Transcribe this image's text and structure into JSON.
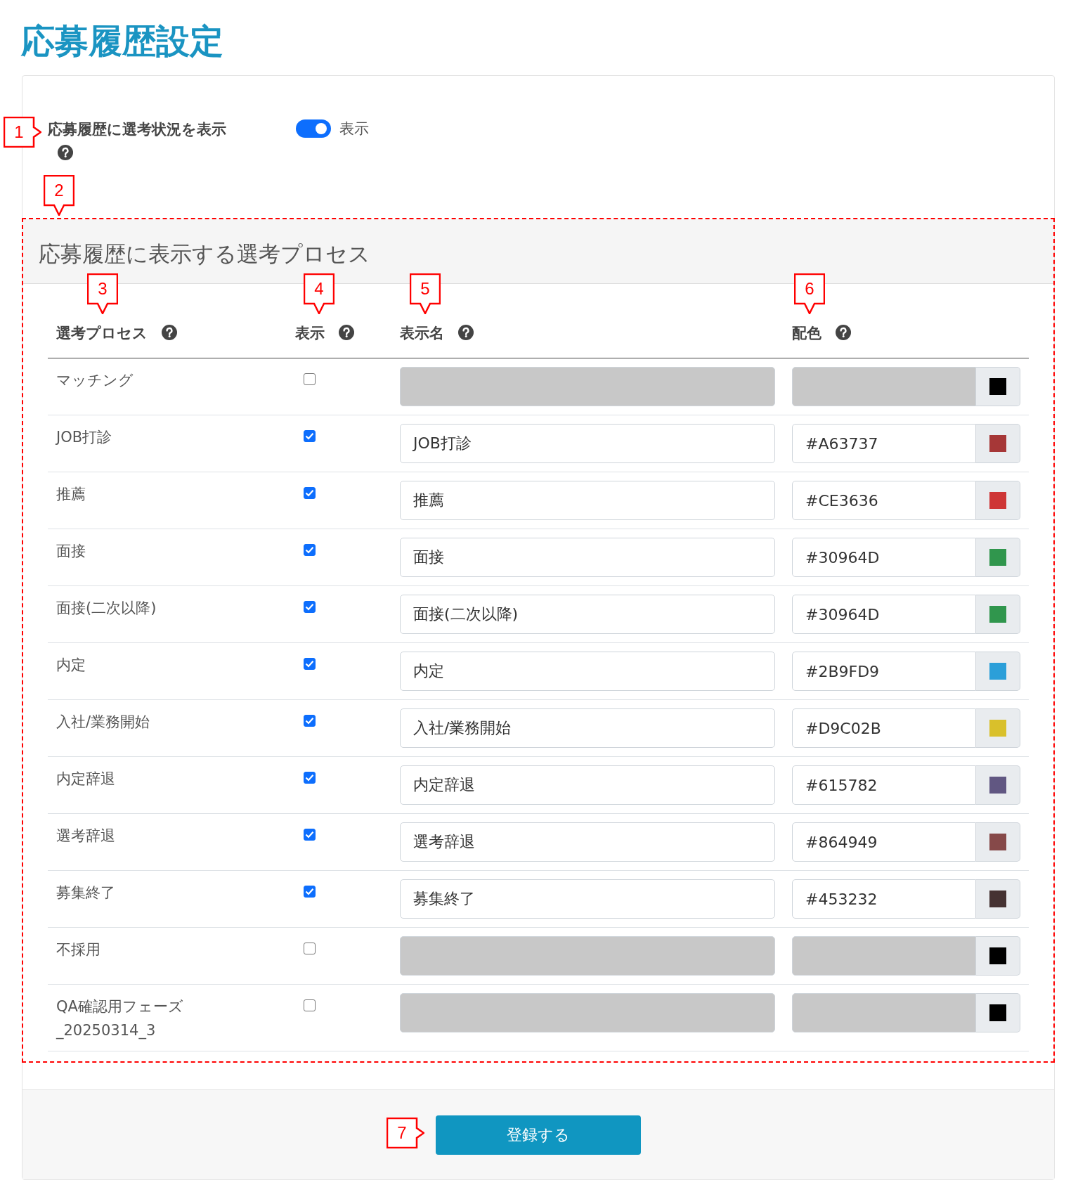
{
  "page_title": "応募履歴設定",
  "display_setting": {
    "label": "応募履歴に選考状況を表示",
    "on": true,
    "state_label": "表示"
  },
  "process_section": {
    "title": "応募履歴に表示する選考プロセス",
    "columns": [
      "選考プロセス",
      "表示",
      "表示名",
      "配色"
    ],
    "rows": [
      {
        "process": "マッチング",
        "shown": false,
        "color": "#000000"
      },
      {
        "process": "JOB打診",
        "shown": true,
        "display_name": "JOB打診",
        "color_code": "#A63737",
        "color": "#a63737"
      },
      {
        "process": "推薦",
        "shown": true,
        "display_name": "推薦",
        "color_code": "#CE3636",
        "color": "#ce3636"
      },
      {
        "process": "面接",
        "shown": true,
        "display_name": "面接",
        "color_code": "#30964D",
        "color": "#30964d"
      },
      {
        "process": "面接(二次以降)",
        "shown": true,
        "display_name": "面接(二次以降)",
        "color_code": "#30964D",
        "color": "#30964d"
      },
      {
        "process": "内定",
        "shown": true,
        "display_name": "内定",
        "color_code": "#2B9FD9",
        "color": "#2b9fd9"
      },
      {
        "process": "入社/業務開始",
        "shown": true,
        "display_name": "入社/業務開始",
        "color_code": "#D9C02B",
        "color": "#d9c02b"
      },
      {
        "process": "内定辞退",
        "shown": true,
        "display_name": "内定辞退",
        "color_code": "#615782",
        "color": "#615782"
      },
      {
        "process": "選考辞退",
        "shown": true,
        "display_name": "選考辞退",
        "color_code": "#864949",
        "color": "#864949"
      },
      {
        "process": "募集終了",
        "shown": true,
        "display_name": "募集終了",
        "color_code": "#453232",
        "color": "#453232"
      },
      {
        "process": "不採用",
        "shown": false,
        "color": "#000000"
      },
      {
        "process": "QA確認用フェーズ\n_20250314_3",
        "shown": false,
        "color": "#000000"
      }
    ]
  },
  "submit_button": "登録する",
  "callouts": [
    {
      "number": "1"
    },
    {
      "number": "2"
    },
    {
      "number": "3"
    },
    {
      "number": "4"
    },
    {
      "number": "5"
    },
    {
      "number": "6"
    },
    {
      "number": "7"
    }
  ]
}
